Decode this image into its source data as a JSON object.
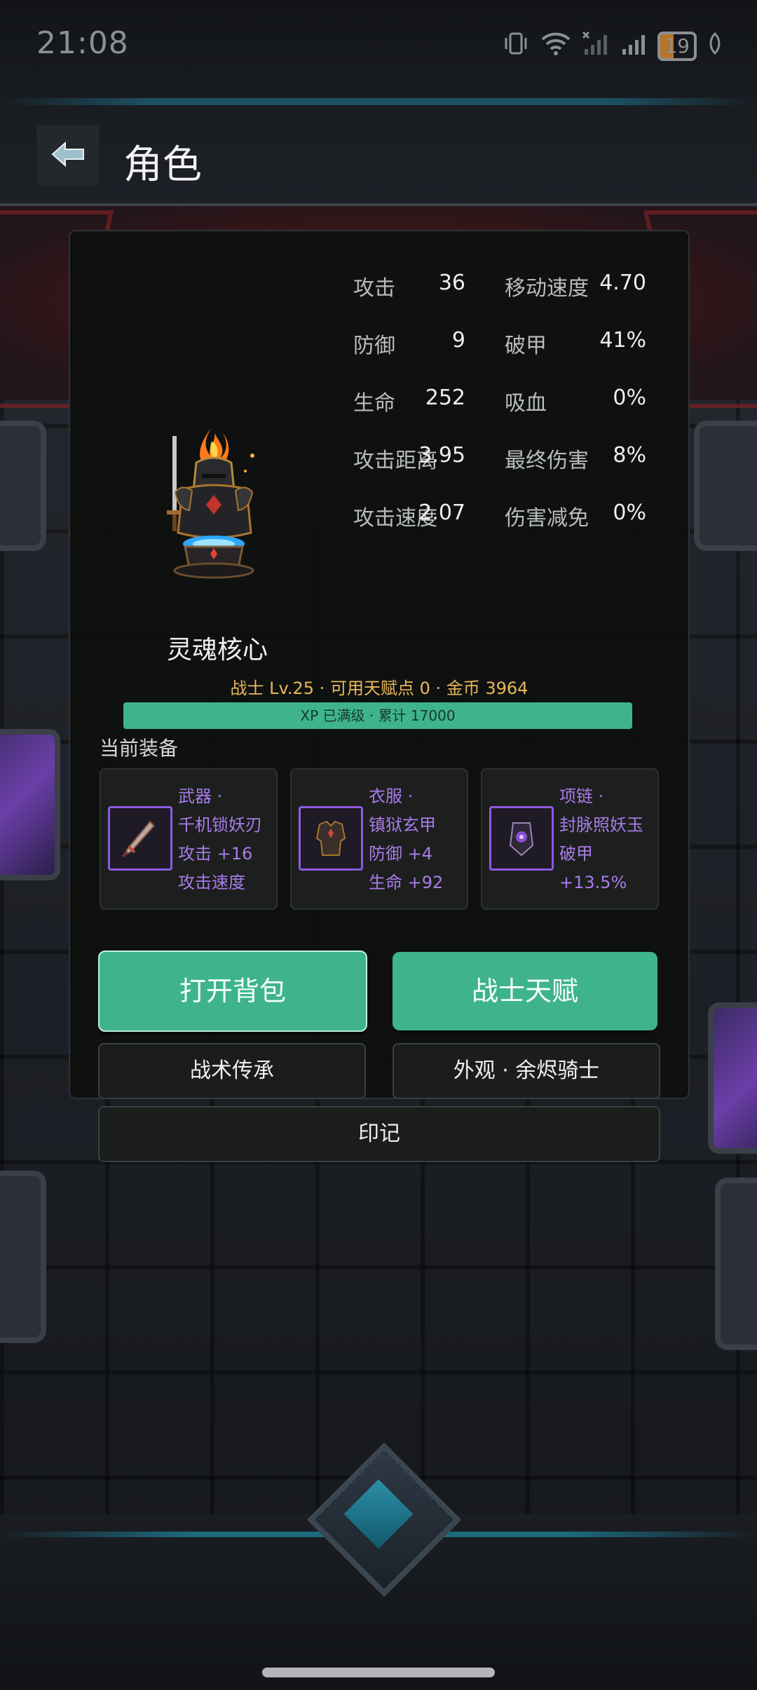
{
  "status_bar": {
    "time": "21:08",
    "battery": "19"
  },
  "header": {
    "title": "角色"
  },
  "hero": {
    "name": "灵魂核心"
  },
  "stats": [
    {
      "label1": "攻击",
      "value1": "36",
      "label2": "移动速度",
      "value2": "4.70"
    },
    {
      "label1": "防御",
      "value1": "9",
      "label2": "破甲",
      "value2": "41%"
    },
    {
      "label1": "生命",
      "value1": "252",
      "label2": "吸血",
      "value2": "0%"
    },
    {
      "label1": "攻击距离",
      "value1": "3.95",
      "label2": "最终伤害",
      "value2": "8%"
    },
    {
      "label1": "攻击速度",
      "value1": "2.07",
      "label2": "伤害减免",
      "value2": "0%"
    }
  ],
  "meta": "战士 Lv.25 · 可用天赋点 0 · 金币 3964",
  "xp": {
    "label": "XP 已满级 · 累计 17000",
    "fill_fraction": 1.0
  },
  "equipment": {
    "title": "当前装备",
    "items": [
      {
        "slot": "武器 ·",
        "name": "千机锁妖刃",
        "stat1": "攻击 +16",
        "stat2": "攻击速度"
      },
      {
        "slot": "衣服 ·",
        "name": "镇狱玄甲",
        "stat1": "防御 +4",
        "stat2": "生命 +92"
      },
      {
        "slot": "项链 ·",
        "name": "封脉照妖玉",
        "stat1": "破甲",
        "stat2": "+13.5%"
      }
    ]
  },
  "buttons": {
    "open_bag": "打开背包",
    "warrior_talent": "战士天赋",
    "tactics": "战术传承",
    "appearance": "外观 · 余烬骑士",
    "mark": "印记"
  },
  "colors": {
    "accent": "#3fb48c",
    "gold": "#e8b85a",
    "epic": "#a97be8"
  }
}
